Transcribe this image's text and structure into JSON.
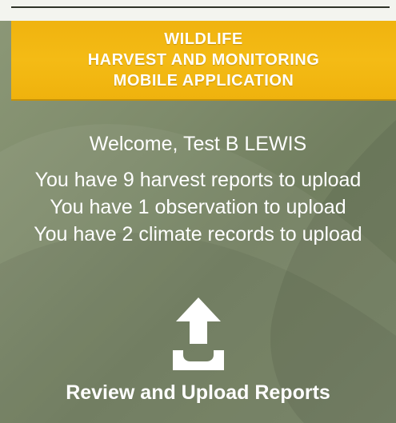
{
  "header": {
    "lines": [
      "WILDLIFE",
      "HARVEST AND MONITORING",
      "MOBILE APPLICATION"
    ],
    "background_color": "#f4bb15",
    "text_color": "#ffffff"
  },
  "main": {
    "welcome": "Welcome, Test B LEWIS",
    "pending": {
      "harvest": "You have 9 harvest reports to upload",
      "observation": "You have 1 observation to upload",
      "climate": "You have 2 climate records to upload"
    },
    "background_color": "#7d8a6a"
  },
  "upload": {
    "icon": "upload-tray-icon",
    "label": "Review and Upload Reports"
  }
}
